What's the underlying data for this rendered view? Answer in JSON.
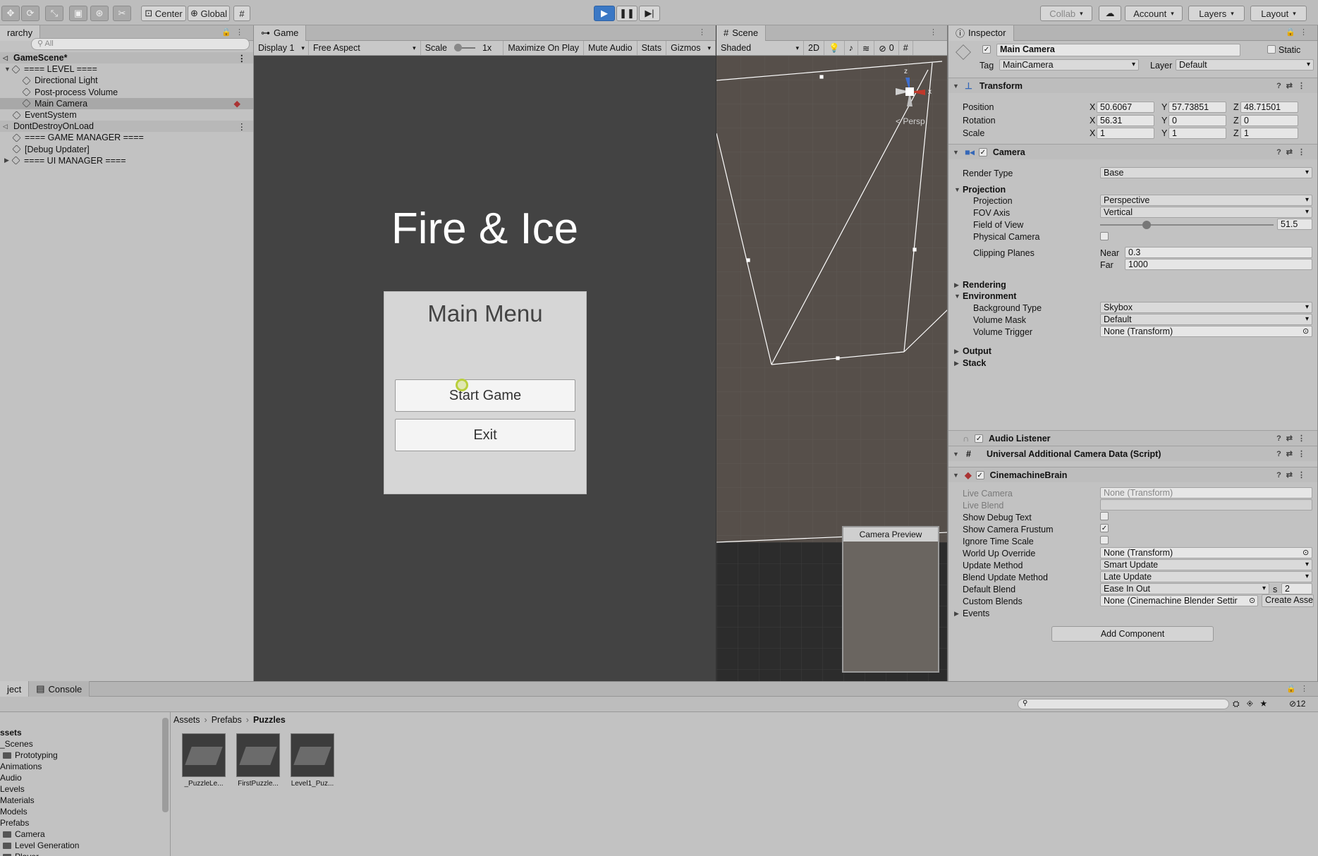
{
  "toolbar": {
    "pivot": "Center",
    "space": "Global",
    "collab": "Collab",
    "account": "Account",
    "layers": "Layers",
    "layout": "Layout"
  },
  "hierarchy": {
    "tab": "rarchy",
    "search_placeholder": "All",
    "rows": [
      {
        "label": "GameScene*",
        "type": "scene"
      },
      {
        "label": "==== LEVEL ====",
        "type": "group"
      },
      {
        "label": "Directional Light",
        "type": "child"
      },
      {
        "label": "Post-process Volume",
        "type": "child"
      },
      {
        "label": "Main Camera",
        "type": "child-selected"
      },
      {
        "label": "EventSystem",
        "type": "item"
      },
      {
        "label": "DontDestroyOnLoad",
        "type": "scene"
      },
      {
        "label": "==== GAME MANAGER ====",
        "type": "item"
      },
      {
        "label": "[Debug Updater]",
        "type": "item"
      },
      {
        "label": "==== UI MANAGER ====",
        "type": "group-collapsed"
      }
    ]
  },
  "game": {
    "tab": "Game",
    "display": "Display 1",
    "aspect": "Free Aspect",
    "scale_label": "Scale",
    "scale_value": "1x",
    "maximize": "Maximize On Play",
    "mute": "Mute Audio",
    "stats": "Stats",
    "gizmos": "Gizmos",
    "title": "Fire & Ice",
    "menu_title": "Main Menu",
    "start": "Start Game",
    "exit": "Exit"
  },
  "scene": {
    "tab": "Scene",
    "shading": "Shaded",
    "mode2d": "2D",
    "hidden_count": "0",
    "persp": "< Persp",
    "preview_title": "Camera Preview",
    "axis_z": "z",
    "axis_x": "x"
  },
  "inspector": {
    "tab": "Inspector",
    "object_name": "Main Camera",
    "static": "Static",
    "tag_label": "Tag",
    "tag": "MainCamera",
    "layer_label": "Layer",
    "layer": "Default",
    "transform": {
      "title": "Transform",
      "position_label": "Position",
      "pos": [
        "50.6067",
        "57.73851",
        "48.71501"
      ],
      "rotation_label": "Rotation",
      "rot": [
        "56.31",
        "0",
        "0"
      ],
      "scale_label": "Scale",
      "scl": [
        "1",
        "1",
        "1"
      ]
    },
    "camera": {
      "title": "Camera",
      "render_type_label": "Render Type",
      "render_type": "Base",
      "projection_header": "Projection",
      "projection_label": "Projection",
      "projection": "Perspective",
      "fov_axis_label": "FOV Axis",
      "fov_axis": "Vertical",
      "fov_label": "Field of View",
      "fov": "51.5",
      "fov_fraction": 0.27,
      "physical_label": "Physical Camera",
      "clipping_label": "Clipping Planes",
      "near_label": "Near",
      "near": "0.3",
      "far_label": "Far",
      "far": "1000",
      "rendering": "Rendering",
      "environment": "Environment",
      "bg_type_label": "Background Type",
      "bg_type": "Skybox",
      "volume_mask_label": "Volume Mask",
      "volume_mask": "Default",
      "volume_trigger_label": "Volume Trigger",
      "volume_trigger": "None (Transform)",
      "output": "Output",
      "stack": "Stack"
    },
    "audio_listener": "Audio Listener",
    "urp_data": "Universal Additional Camera Data (Script)",
    "brain": {
      "title": "CinemachineBrain",
      "live_camera_label": "Live Camera",
      "live_camera": "None (Transform)",
      "live_blend_label": "Live Blend",
      "debug_text_label": "Show Debug Text",
      "frustum_label": "Show Camera Frustum",
      "ignore_time_label": "Ignore Time Scale",
      "world_up_label": "World Up Override",
      "world_up": "None (Transform)",
      "update_method_label": "Update Method",
      "update_method": "Smart Update",
      "blend_update_label": "Blend Update Method",
      "blend_update": "Late Update",
      "default_blend_label": "Default Blend",
      "default_blend": "Ease In Out",
      "blend_s": "s",
      "blend_time": "2",
      "custom_blends_label": "Custom Blends",
      "custom_blends": "None (Cinemachine Blender Settir",
      "create_asset": "Create Asset",
      "events": "Events"
    },
    "add_component": "Add Component"
  },
  "project": {
    "tab": "ject",
    "console_tab": "Console",
    "hidden_count": "12",
    "tree": [
      {
        "label": "ssets",
        "level": 0,
        "bold": true
      },
      {
        "label": "_Scenes",
        "level": 0
      },
      {
        "label": "Prototyping",
        "level": 1
      },
      {
        "label": "Animations",
        "level": 0
      },
      {
        "label": "Audio",
        "level": 0
      },
      {
        "label": "Levels",
        "level": 0
      },
      {
        "label": "Materials",
        "level": 0
      },
      {
        "label": "Models",
        "level": 0
      },
      {
        "label": "Prefabs",
        "level": 0
      },
      {
        "label": "Camera",
        "level": 1
      },
      {
        "label": "Level Generation",
        "level": 1
      },
      {
        "label": "Player",
        "level": 1
      }
    ],
    "breadcrumb": [
      "Assets",
      "Prefabs",
      "Puzzles"
    ],
    "assets": [
      "_PuzzleLe...",
      "FirstPuzzle...",
      "Level1_Puz..."
    ]
  }
}
